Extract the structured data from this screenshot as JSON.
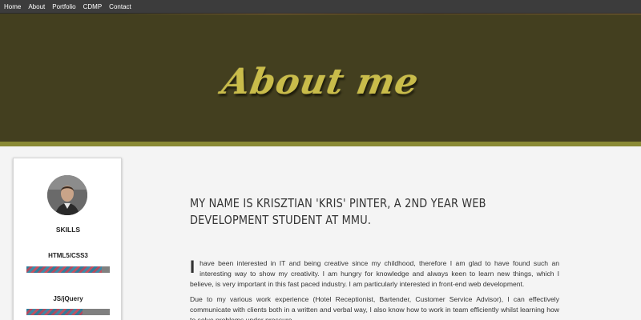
{
  "nav": {
    "items": [
      "Home",
      "About",
      "Portfolio",
      "CDMP",
      "Contact"
    ]
  },
  "hero": {
    "title": "About me"
  },
  "sidebar": {
    "skills_heading": "SKILLS",
    "skills": [
      {
        "label": "HTML5/CSS3",
        "level": 0.9
      },
      {
        "label": "JS/jQuery",
        "level": 0.67
      }
    ]
  },
  "main": {
    "intro": "My name is Krisztian 'Kris' Pinter, a 2nd year web development student at MMU.",
    "para1_dropcap": "I",
    "para1_text": "have been interested in IT and being creative since my childhood, therefore I am glad to have found such an interesting way to show my creativity. I am hungry for knowledge and always keen to learn new things, which I believe, is very important in this fast paced industry. I am particularly interested in front-end web development.",
    "para2_text": "Due to my various work experience (Hotel Receptionist, Bartender, Customer Service Advisor), I can effectively communicate with clients both in a written and verbal way, I also know how to work in team efficiently whilst learning how to solve problems under pressure."
  },
  "colors": {
    "nav_bg": "#3c3c3c",
    "hero_bg": "#433f1f",
    "hero_title": "#c9bc4a",
    "hero_strip": "#8a8a35",
    "page_bg": "#f4f4f4"
  }
}
